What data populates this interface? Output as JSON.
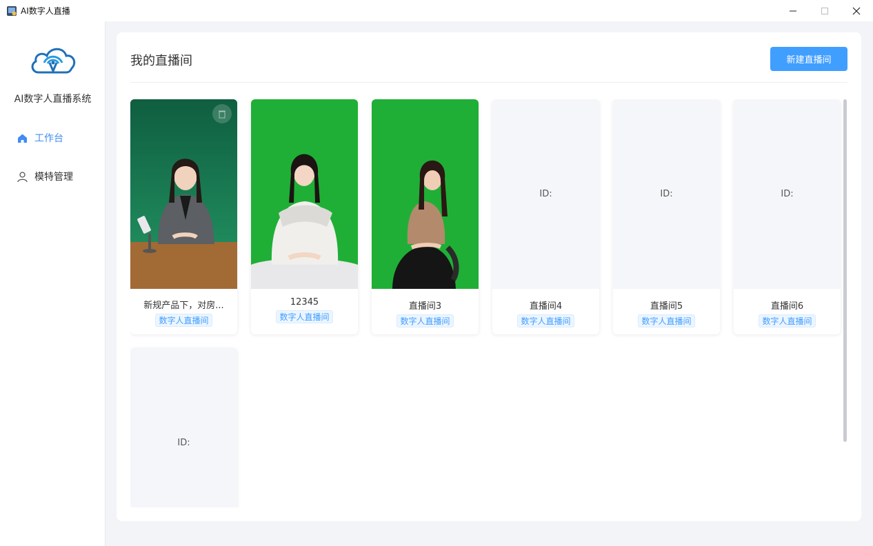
{
  "window": {
    "title": "AI数字人直播",
    "app_icon": "app-icon",
    "controls": [
      "minimize-icon",
      "maximize-icon",
      "close-icon"
    ]
  },
  "sidebar": {
    "logo": "cloud-broadcast-logo",
    "brand": "AI数字人直播系统",
    "items": [
      {
        "label": "工作台",
        "icon": "home-icon",
        "active": true
      },
      {
        "label": "模特管理",
        "icon": "user-icon",
        "active": false
      }
    ]
  },
  "main": {
    "title": "我的直播间",
    "new_button": "新建直播间",
    "rooms": [
      {
        "name": "新规产品下，对房...",
        "tag": "数字人直播间",
        "thumb": "presenter-seated-at-desk",
        "has_image": true
      },
      {
        "name": "12345",
        "tag": "数字人直播间",
        "thumb": "presenter-white-top-green-screen",
        "has_image": true
      },
      {
        "name": "直播间3",
        "tag": "数字人直播间",
        "thumb": "presenter-seated-green-screen",
        "has_image": true
      },
      {
        "name": "直播间4",
        "tag": "数字人直播间",
        "placeholder": "ID:",
        "has_image": false
      },
      {
        "name": "直播间5",
        "tag": "数字人直播间",
        "placeholder": "ID:",
        "has_image": false
      },
      {
        "name": "直播间6",
        "tag": "数字人直播间",
        "placeholder": "ID:",
        "has_image": false
      },
      {
        "name": "",
        "tag": "",
        "placeholder": "ID:",
        "has_image": false
      }
    ]
  },
  "colors": {
    "accent": "#409eff",
    "nav_active": "#3f8cf2",
    "green_screen": "#1faf36",
    "background": "#f3f4f8"
  }
}
